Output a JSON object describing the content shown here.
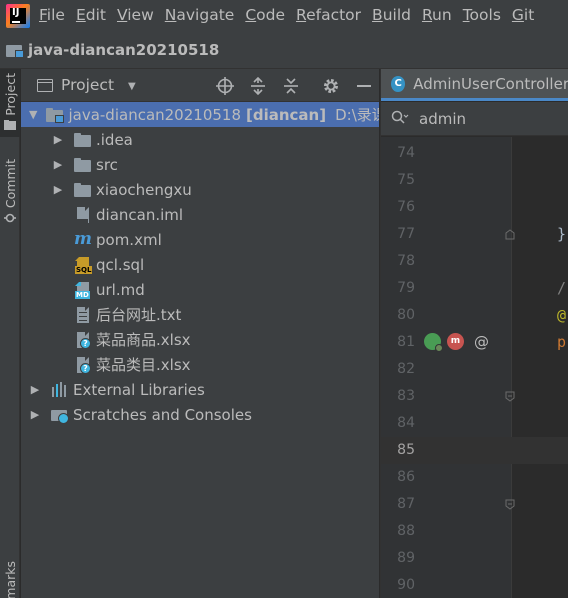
{
  "menu": {
    "items": [
      {
        "mnemonic": "F",
        "rest": "ile"
      },
      {
        "mnemonic": "E",
        "rest": "dit"
      },
      {
        "mnemonic": "V",
        "rest": "iew"
      },
      {
        "mnemonic": "N",
        "rest": "avigate"
      },
      {
        "mnemonic": "C",
        "rest": "ode"
      },
      {
        "mnemonic": "R",
        "rest": "efactor"
      },
      {
        "mnemonic": "B",
        "rest": "uild"
      },
      {
        "mnemonic": "R",
        "rest": "un"
      },
      {
        "mnemonic": "T",
        "rest": "ools"
      },
      {
        "mnemonic": "G",
        "rest": "it"
      }
    ]
  },
  "navbar": {
    "project_name": "java-diancan20210518"
  },
  "left_strip": {
    "project_tab": "Project",
    "commit_tab": "Commit",
    "bookmarks_tab": "marks"
  },
  "project_panel": {
    "title": "Project",
    "tree": {
      "root": {
        "name": "java-diancan20210518",
        "module": "[diancan]",
        "path": "D:\\录课和"
      },
      "items": [
        {
          "label": ".idea"
        },
        {
          "label": "src"
        },
        {
          "label": "xiaochengxu"
        },
        {
          "label": "diancan.iml"
        },
        {
          "label": "pom.xml"
        },
        {
          "label": "qcl.sql"
        },
        {
          "label": "url.md"
        },
        {
          "label": "后台网址.txt"
        },
        {
          "label": "菜品商品.xlsx"
        },
        {
          "label": "菜品类目.xlsx"
        }
      ],
      "external_libraries": "External Libraries",
      "scratches": "Scratches and Consoles"
    }
  },
  "editor": {
    "tab_title": "AdminUserController",
    "search_value": "admin",
    "lines": [
      {
        "num": "74",
        "code": ""
      },
      {
        "num": "75",
        "code": ""
      },
      {
        "num": "76",
        "code": ""
      },
      {
        "num": "77",
        "code": "}"
      },
      {
        "num": "78",
        "code": ""
      },
      {
        "num": "79",
        "code": "/"
      },
      {
        "num": "80",
        "code": "@"
      },
      {
        "num": "81",
        "code": "p"
      },
      {
        "num": "82",
        "code": ""
      },
      {
        "num": "83",
        "code": ""
      },
      {
        "num": "84",
        "code": ""
      },
      {
        "num": "85",
        "code": ""
      },
      {
        "num": "86",
        "code": ""
      },
      {
        "num": "87",
        "code": ""
      },
      {
        "num": "88",
        "code": ""
      },
      {
        "num": "89",
        "code": ""
      },
      {
        "num": "90",
        "code": ""
      }
    ],
    "gutter_at_symbol": "@",
    "colors": {
      "annotation": "#bbb529",
      "keyword": "#cc7832",
      "comment": "#808080",
      "plain": "#a9b7c6",
      "selection": "#4b6eaf",
      "tab_underline": "#4a88c7"
    }
  }
}
